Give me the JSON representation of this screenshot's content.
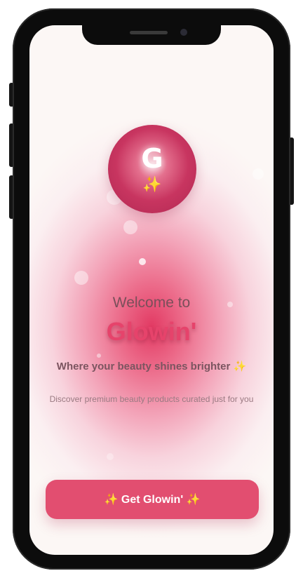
{
  "logo": {
    "letter": "G",
    "sparkle": "✨"
  },
  "welcome": "Welcome to",
  "brand": "Glowin'",
  "tagline": "Where your beauty shines brighter ✨",
  "description": "Discover premium beauty products curated just for you",
  "cta": {
    "label": "✨ Get Glowin' ✨"
  },
  "colors": {
    "accent": "#e24e70",
    "brand": "#e6436b",
    "logo": "#c83560"
  }
}
